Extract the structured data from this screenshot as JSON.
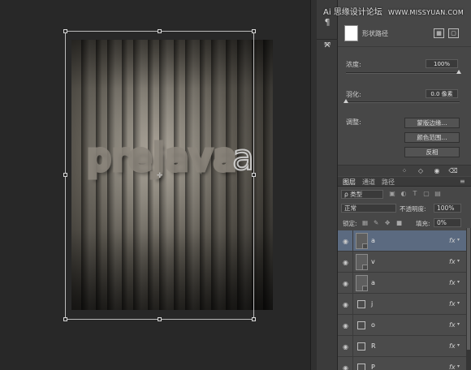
{
  "watermark": {
    "site": "思缘设计论坛",
    "url": "WWW.MISSYUAN.COM",
    "prefix": "Ai"
  },
  "canvas": {
    "art_text": "prejava",
    "overflow_glyph": "a",
    "pivot_glyph": "✛"
  },
  "properties": {
    "shape_label": "形状路径",
    "density_label": "浓度:",
    "density_value": "100%",
    "feather_label": "羽化:",
    "feather_value": "0.0 像素",
    "adjust_label": "调整:",
    "buttons": [
      "蒙版边缘...",
      "颜色范围...",
      "反相"
    ]
  },
  "layers_panel": {
    "tabs": [
      "图层",
      "通道",
      "路径"
    ],
    "filter_kind": "ρ 类型",
    "blend_mode": "正常",
    "opacity_label": "不透明度:",
    "opacity_value": "100%",
    "lock_label": "锁定:",
    "fill_label": "填充:",
    "fill_value": "0%",
    "layers": [
      {
        "name": "a",
        "fx": "fx",
        "selected": true
      },
      {
        "name": "v",
        "fx": "fx",
        "selected": false
      },
      {
        "name": "a",
        "fx": "fx",
        "selected": false
      },
      {
        "name": "j",
        "fx": "fx",
        "selected": false
      },
      {
        "name": "o",
        "fx": "fx",
        "selected": false
      },
      {
        "name": "R",
        "fx": "fx",
        "selected": false
      },
      {
        "name": "P",
        "fx": "fx",
        "selected": false
      }
    ]
  },
  "colors": {
    "selection": "#5b6a80",
    "panel": "#474747",
    "canvas_bg": "#282828"
  }
}
